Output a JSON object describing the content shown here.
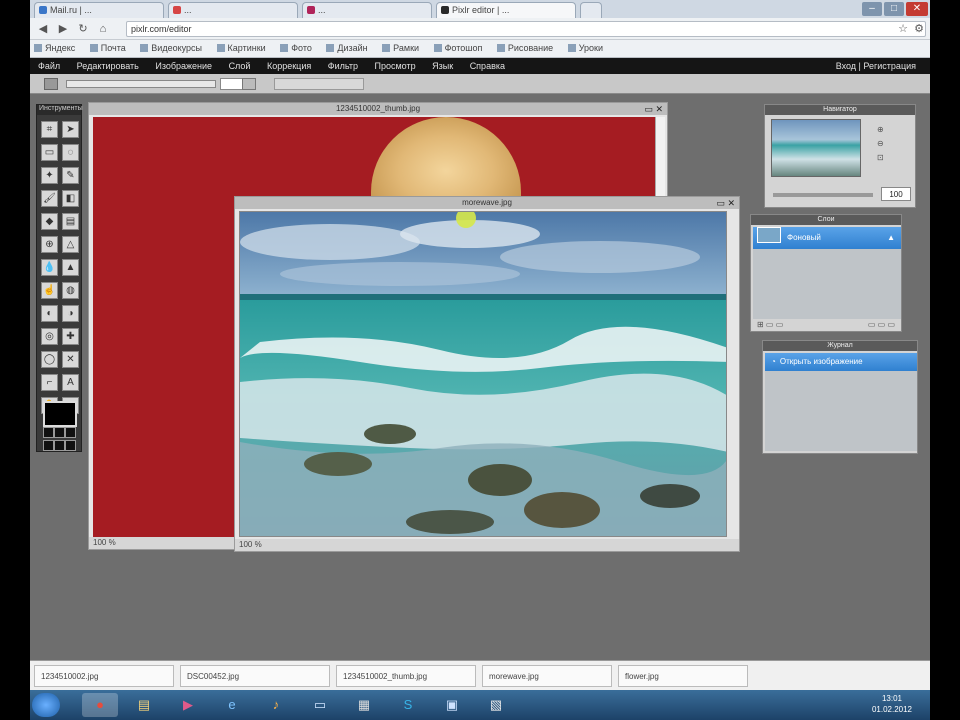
{
  "browser": {
    "tabs": [
      {
        "label": "Mail.ru | ...",
        "color": "#3a76c8"
      },
      {
        "label": "...",
        "color": "#d64545"
      },
      {
        "label": "...",
        "color": "#b0245a"
      },
      {
        "label": "Pixlr editor | ...",
        "color": "#2a2a2a"
      }
    ],
    "url": "pixlr.com/editor",
    "bookmarks": [
      "Яндекс",
      "Почта",
      "Видеокурсы",
      "Картинки",
      "Фото",
      "Дизайн",
      "Рамки",
      "Фотошоп",
      "Рисование",
      "Уроки"
    ]
  },
  "editor": {
    "menus": [
      "Файл",
      "Редактировать",
      "Изображение",
      "Слой",
      "Коррекция",
      "Фильтр",
      "Просмотр",
      "Язык",
      "Справка"
    ],
    "menu_right": "Вход | Регистрация",
    "tools_title": "Инструменты",
    "portrait_window": {
      "title": "1234510002_thumb.jpg",
      "zoom": "100 %",
      "bg_color": "#a51c22"
    },
    "sea_window": {
      "title": "morewave.jpg",
      "zoom": "100 %"
    },
    "panels": {
      "navigator": {
        "title": "Навигатор",
        "zoom": "100"
      },
      "layers": {
        "title": "Слои",
        "layer_name": "Фоновый"
      },
      "history": {
        "title": "Журнал",
        "item": "Открыть изображение"
      }
    }
  },
  "doc_tabs": [
    "1234510002.jpg",
    "DSC00452.jpg",
    "1234510002_thumb.jpg",
    "morewave.jpg",
    "flower.jpg"
  ],
  "taskbar": {
    "apps": [
      {
        "icon": "windows-start-icon",
        "glyph": "◉"
      },
      {
        "icon": "chrome-icon",
        "glyph": "●"
      },
      {
        "icon": "folder-icon",
        "glyph": "▤"
      },
      {
        "icon": "video-icon",
        "glyph": "▶"
      },
      {
        "icon": "ie-icon",
        "glyph": "e"
      },
      {
        "icon": "media-icon",
        "glyph": "♪"
      },
      {
        "icon": "monitor-icon",
        "glyph": "▭"
      },
      {
        "icon": "doc-icon",
        "glyph": "▦"
      },
      {
        "icon": "skype-icon",
        "glyph": "S"
      },
      {
        "icon": "window-icon",
        "glyph": "▣"
      },
      {
        "icon": "image-icon",
        "glyph": "▧"
      }
    ],
    "clock_time": "13:01",
    "clock_date": "01.02.2012"
  }
}
